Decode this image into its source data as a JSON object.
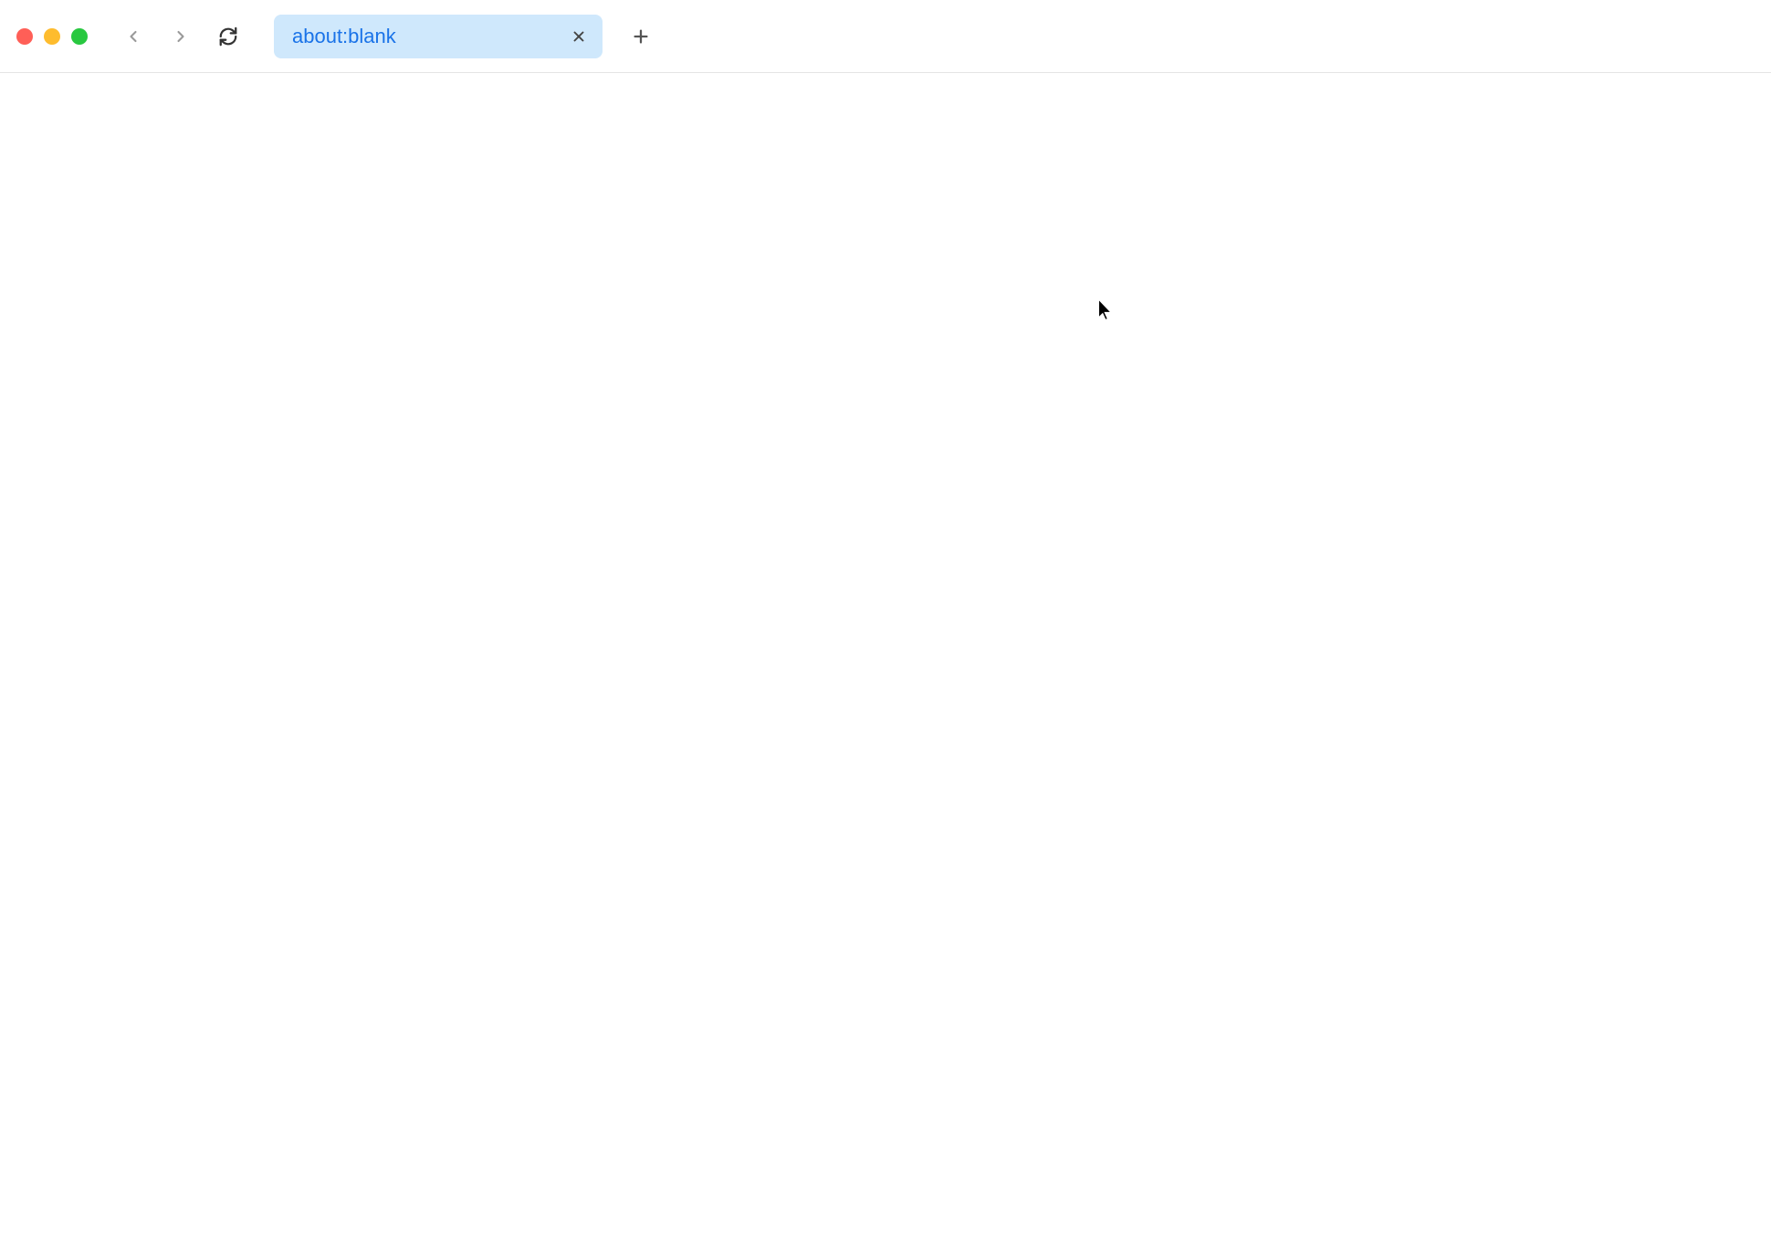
{
  "browser": {
    "tabs": [
      {
        "title": "about:blank",
        "active": true
      }
    ],
    "navigation": {
      "back_enabled": false,
      "forward_enabled": false
    }
  }
}
